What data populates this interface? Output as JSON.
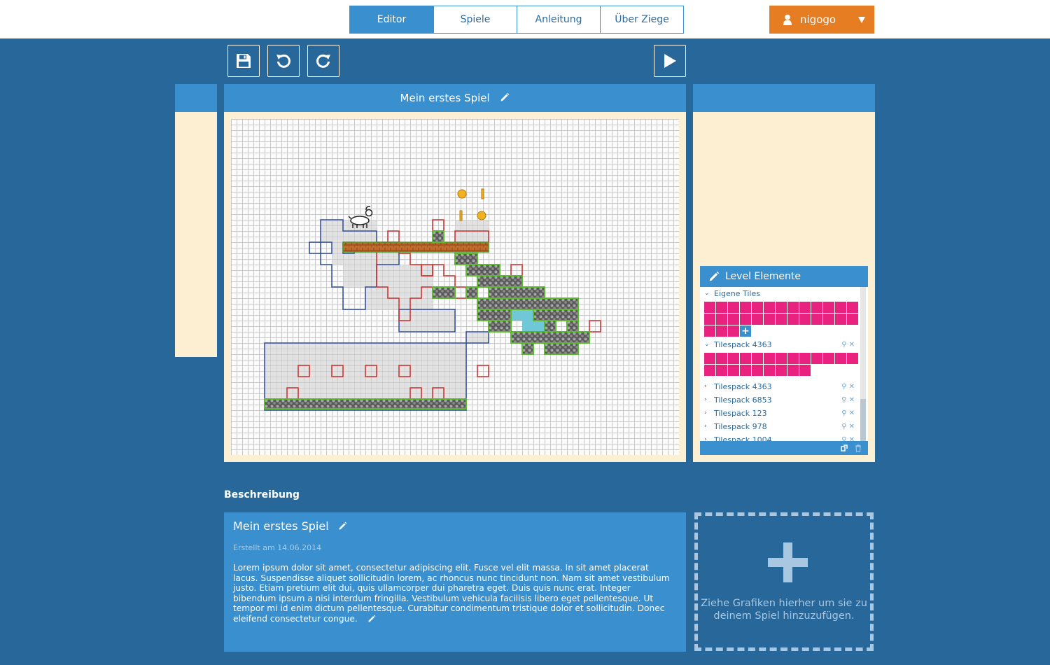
{
  "nav": {
    "tabs": [
      {
        "label": "Editor",
        "active": true
      },
      {
        "label": "Spiele",
        "active": false
      },
      {
        "label": "Anleitung",
        "active": false
      },
      {
        "label": "Über Ziege",
        "active": false
      }
    ],
    "user": {
      "name": "nigogo"
    }
  },
  "colors": {
    "background": "#27679a",
    "accent_blue": "#3a8fcf",
    "cream": "#fdf0d2",
    "user_orange": "#e67d22",
    "tile_pink": "#e8227e"
  },
  "toolbar": {
    "icons": [
      "save-icon",
      "undo-icon",
      "redo-icon",
      "play-icon"
    ]
  },
  "editor": {
    "game_title": "Mein erstes Spiel"
  },
  "level_elements": {
    "title": "Level Elemente",
    "own_tiles": {
      "label": "Eigene Tiles",
      "tile_count": 29
    },
    "open_pack": {
      "label": "Tilespack 4363",
      "tile_count": 22
    },
    "packs": [
      {
        "label": "Tilespack 4363"
      },
      {
        "label": "Tilespack 6853"
      },
      {
        "label": "Tilespack 123"
      },
      {
        "label": "Tilespack 978"
      },
      {
        "label": "Tilespack 1004"
      }
    ]
  },
  "description": {
    "section_label": "Beschreibung",
    "title": "Mein erstes Spiel",
    "created": "Erstellt am 14.06.2014",
    "text": "Lorem ipsum dolor sit amet, consectetur adipiscing elit. Fusce vel elit massa. In sit amet placerat lacus. Suspendisse aliquet sollicitudin lorem, ac rhoncus nunc tincidunt non. Nam sit amet vestibulum justo. Etiam pretium elit dui, quis ullamcorper dui pharetra eget. Duis quis nunc erat. Integer bibendum ipsum a nisi interdum fringilla. Vestibulum vehicula facilisis libero eget pellentesque. Ut tempor mi id enim dictum pellentesque. Curabitur condimentum tristique dolor et sollicitudin. Donec eleifend consectetur congue."
  },
  "dropzone": {
    "text": "Ziehe Grafiken hierher um sie zu deinem Spiel hinzuzufügen."
  }
}
